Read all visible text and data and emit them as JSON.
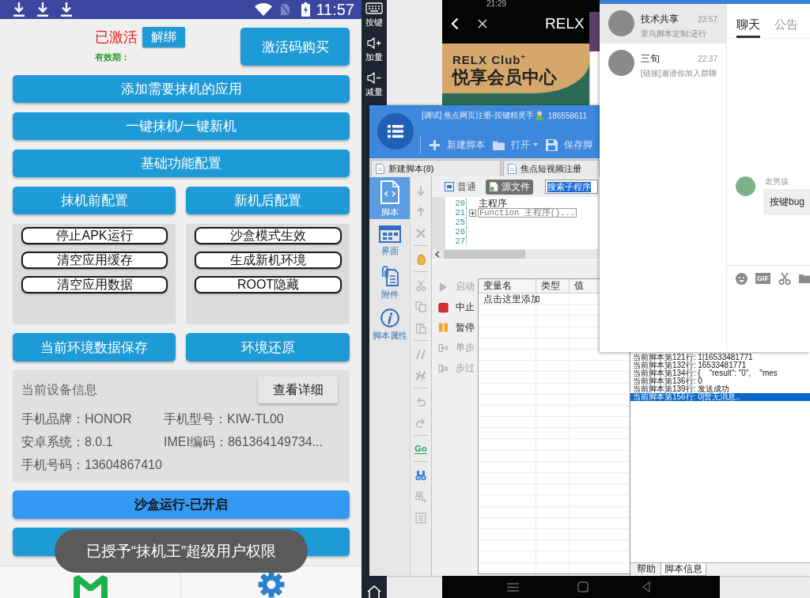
{
  "phone": {
    "status_bar": {
      "time": "11:57"
    },
    "activation": {
      "status": "已激活",
      "unbind_button": "解绑",
      "validity_label": "有效期：",
      "buy_button": "激活码购买"
    },
    "main_buttons": [
      "添加需要抹机的应用",
      "一键抹机/一键新机",
      "基础功能配置"
    ],
    "config_columns": [
      {
        "title": "抹机前配置",
        "options": [
          "停止APK运行",
          "清空应用缓存",
          "清空应用数据"
        ]
      },
      {
        "title": "新机后配置",
        "options": [
          "沙盒模式生效",
          "生成新机环境",
          "ROOT隐藏"
        ]
      }
    ],
    "env_buttons": [
      "当前环境数据保存",
      "环境还原"
    ],
    "device_info": {
      "title": "当前设备信息",
      "details_button": "查看详细",
      "fields": [
        "手机品牌：HONOR",
        "手机型号：KIW-TL00",
        "安卓系统：8.0.1",
        "IMEI编码：861364149734...",
        "手机号码：13604867410"
      ]
    },
    "sandbox_button": "沙盒运行-已开启",
    "toast": "已授予“抹机王”超级用户权限"
  },
  "emulator": {
    "side_buttons": [
      {
        "kind": "keyboard",
        "label": "按键"
      },
      {
        "kind": "louder",
        "label": "加量"
      },
      {
        "kind": "quieter",
        "label": "减量"
      }
    ],
    "screen": {
      "time": "21:29",
      "title": "RELX",
      "banner": {
        "brand": "RELX Club$^{+}$",
        "headline": "悦享会员中心"
      }
    }
  },
  "script_editor": {
    "title": "[调试] 焦点网页注册-按键精灵手",
    "account": "186558611",
    "toolbar": [
      {
        "kind": "new",
        "label": "新建脚本"
      },
      {
        "kind": "open",
        "label": "打开"
      },
      {
        "kind": "save",
        "label": "保存脚"
      }
    ],
    "tabs": [
      {
        "label": "新建脚本(8)"
      },
      {
        "label": "焦点短视频注册"
      }
    ],
    "nav": [
      {
        "kind": "script",
        "label": "脚本",
        "selected": true
      },
      {
        "kind": "ui",
        "label": "界面",
        "selected": false
      },
      {
        "kind": "attachment",
        "label": "附件",
        "selected": false
      },
      {
        "kind": "properties",
        "label": "脚本属性",
        "selected": false
      }
    ],
    "goto_label": "Go",
    "view_modes": [
      {
        "kind": "normal",
        "label": "普通",
        "selected": false
      },
      {
        "kind": "source",
        "label": "源文件",
        "selected": true
      }
    ],
    "search": {
      "value": "搜索子程序"
    },
    "code_lines": [
      {
        "number": "20",
        "text": "主程序",
        "folded": false
      },
      {
        "number": "21",
        "text": "Function 主程序()...",
        "folded": true
      },
      {
        "number": "25"
      },
      {
        "number": "26"
      },
      {
        "number": "27"
      }
    ],
    "debug_buttons": [
      {
        "kind": "start",
        "label": "启动",
        "disabled": true
      },
      {
        "kind": "stop",
        "label": "中止",
        "disabled": false
      },
      {
        "kind": "pause",
        "label": "暂停",
        "disabled": false
      },
      {
        "kind": "step",
        "label": "单步",
        "disabled": true
      },
      {
        "kind": "step_over",
        "label": "步过",
        "disabled": true
      }
    ],
    "variables": {
      "columns": [
        "变量名",
        "类型",
        "值"
      ],
      "rows": [
        [
          "点击这里添加"
        ]
      ]
    },
    "log_lines": [
      {
        "text": "当前脚本第121行: 1|16533481771",
        "selected": false
      },
      {
        "text": "当前脚本第132行: 16533481771",
        "selected": false
      },
      {
        "text": "当前脚本第134行: {    \"result\": \"0\",    \"mes",
        "selected": false
      },
      {
        "text": "当前脚本第136行: 0",
        "selected": false
      },
      {
        "text": "当前脚本第139行: 发送成功",
        "selected": false
      },
      {
        "text": "当前脚本第156行: 0|暂无消息..",
        "selected": true
      }
    ],
    "bottom_tabs": [
      {
        "label": "帮助",
        "selected": false
      },
      {
        "label": "脚本信息",
        "selected": true
      }
    ]
  },
  "chat": {
    "conversations": [
      {
        "name": "技术共享",
        "time": "23:57",
        "preview": "菜鸟脚本定制;还行",
        "selected": true
      },
      {
        "name": "三旬",
        "time": "22:37",
        "preview": "[链接]邀请你加入群聊",
        "selected": false
      }
    ],
    "tabs": [
      {
        "label": "聊天",
        "selected": true
      },
      {
        "label": "公告",
        "selected": false
      }
    ],
    "messages": [
      {
        "sender": "老男孩",
        "text": "按键bug"
      }
    ],
    "input_tools": [
      {
        "kind": "emoji"
      },
      {
        "kind": "gif",
        "label": "GIF"
      },
      {
        "kind": "scissors"
      },
      {
        "kind": "folder"
      }
    ]
  }
}
